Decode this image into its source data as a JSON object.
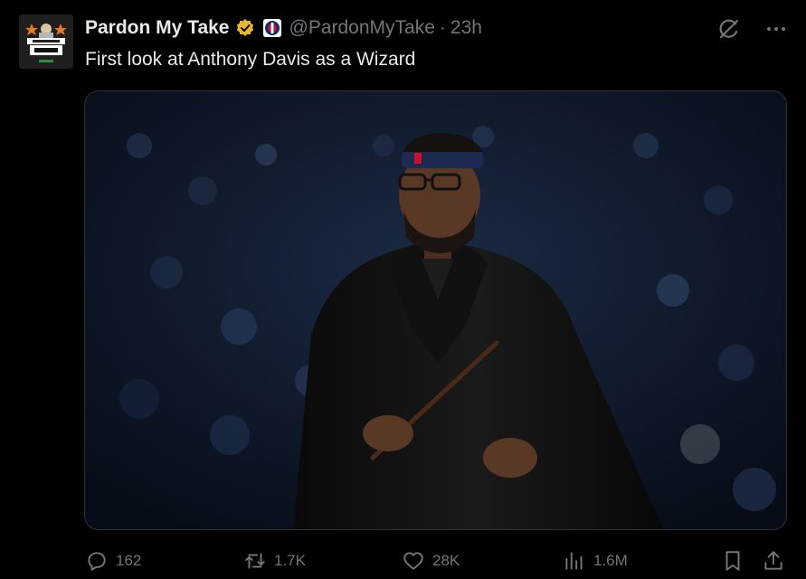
{
  "tweet": {
    "display_name": "Pardon My Take",
    "handle": "@PardonMyTake",
    "separator": "·",
    "time": "23h",
    "text": "First look at Anthony Davis as a Wizard",
    "verified_color": "#e8b829",
    "avatar_text": "PARDON MY TAKE",
    "media_subject": "Anthony Davis in a black wizard robe holding a wand"
  },
  "actions": {
    "replies": "162",
    "reposts": "1.7K",
    "likes": "28K",
    "views": "1.6M"
  },
  "colors": {
    "background": "#000000",
    "primary_text": "#e7e9ea",
    "secondary_text": "#71767b",
    "border": "#2f3336"
  },
  "icons": {
    "top_right": [
      "grok-icon",
      "more-icon"
    ],
    "action_bar": [
      "reply-icon",
      "repost-icon",
      "like-icon",
      "views-icon",
      "bookmark-icon",
      "share-icon"
    ]
  }
}
